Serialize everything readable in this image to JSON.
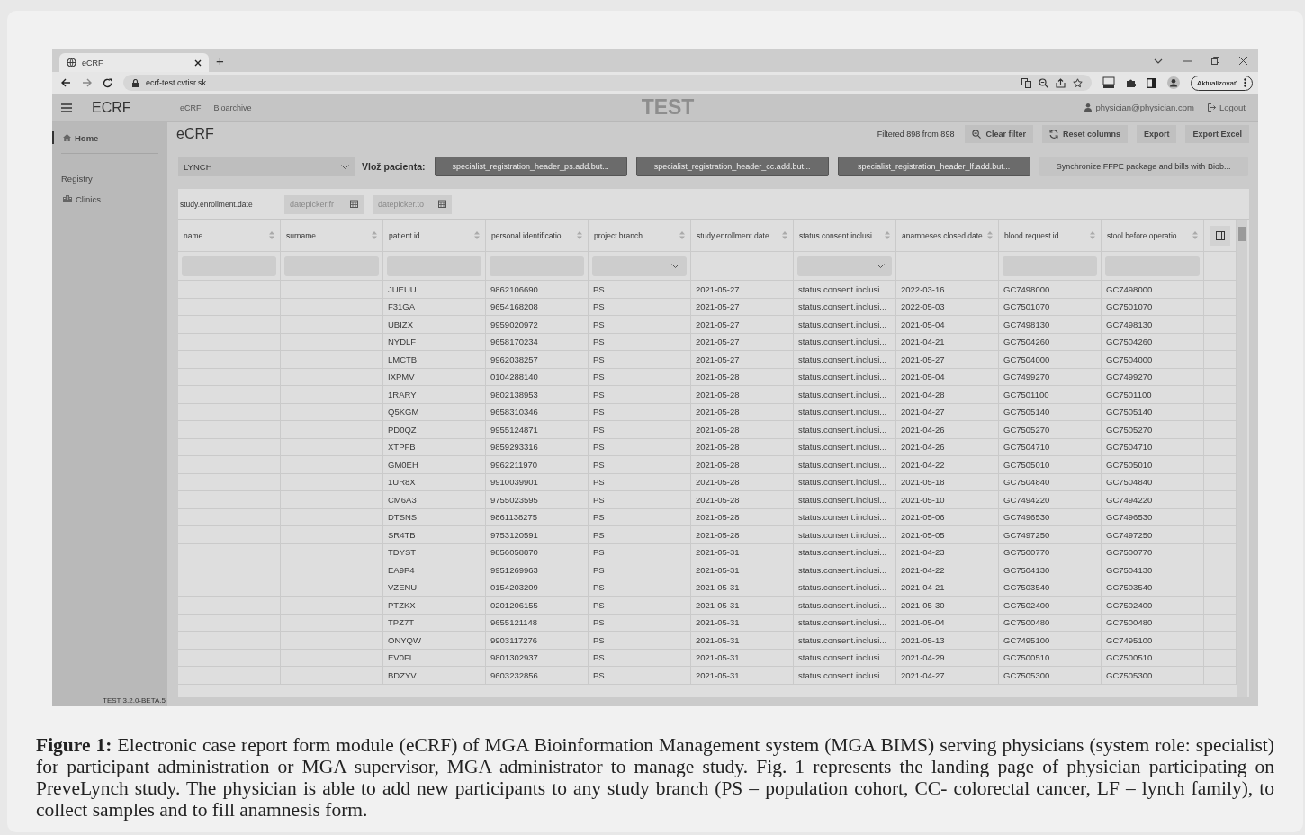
{
  "browser": {
    "tab_title": "eCRF",
    "new_tab": "+",
    "url": "ecrf-test.cvtisr.sk",
    "update_button": "Aktualizovať"
  },
  "app_header": {
    "brand": "ECRF",
    "nav": [
      "eCRF",
      "Bioarchive"
    ],
    "banner": "TEST",
    "user": "physician@physician.com",
    "logout": "Logout"
  },
  "sidebar": {
    "items": [
      {
        "label": "Home",
        "kind": "link",
        "selected": true
      },
      {
        "label": "Registry",
        "kind": "heading",
        "selected": false
      },
      {
        "label": "Clinics",
        "kind": "link",
        "selected": false
      }
    ],
    "version": "TEST 3.2.0-BETA.5"
  },
  "page": {
    "title": "eCRF",
    "filter_status": "Filtered 898 from 898",
    "toolbar": [
      {
        "label": "Clear filter",
        "kind": "clear"
      },
      {
        "label": "Reset columns",
        "kind": "reset"
      },
      {
        "label": "Export",
        "kind": "plain"
      },
      {
        "label": "Export Excel",
        "kind": "plain"
      }
    ]
  },
  "controls": {
    "study_select": "LYNCH",
    "add_label": "Vlož pacienta:",
    "buttons": [
      {
        "label": "specialist_registration_header_ps.add.but...",
        "kind": "dark"
      },
      {
        "label": "specialist_registration_header_cc.add.but...",
        "kind": "dark"
      },
      {
        "label": "specialist_registration_header_lf.add.but...",
        "kind": "dark"
      },
      {
        "label": "Synchronize FFPE package and bills with Biob...",
        "kind": "light"
      }
    ]
  },
  "date_filter": {
    "label": "study.enrollment.date",
    "from_placeholder": "datepicker.fr",
    "to_placeholder": "datepicker.to"
  },
  "table": {
    "columns": [
      {
        "label": "name",
        "kind": "text"
      },
      {
        "label": "surname",
        "kind": "text"
      },
      {
        "label": "patient.id",
        "kind": "text"
      },
      {
        "label": "personal.identificatio...",
        "kind": "text"
      },
      {
        "label": "project.branch",
        "kind": "select"
      },
      {
        "label": "study.enrollment.date",
        "kind": "plain"
      },
      {
        "label": "status.consent.inclusi...",
        "kind": "select"
      },
      {
        "label": "anamneses.closed.date",
        "kind": "plain"
      },
      {
        "label": "blood.request.id",
        "kind": "text"
      },
      {
        "label": "stool.before.operatio...",
        "kind": "text"
      }
    ],
    "rows": [
      [
        "",
        "",
        "JUEUU",
        "9862106690",
        "PS",
        "2021-05-27",
        "status.consent.inclusi...",
        "2022-03-16",
        "GC7498000",
        "GC7498000"
      ],
      [
        "",
        "",
        "F31GA",
        "9654168208",
        "PS",
        "2021-05-27",
        "status.consent.inclusi...",
        "2022-05-03",
        "GC7501070",
        "GC7501070"
      ],
      [
        "",
        "",
        "UBIZX",
        "9959020972",
        "PS",
        "2021-05-27",
        "status.consent.inclusi...",
        "2021-05-04",
        "GC7498130",
        "GC7498130"
      ],
      [
        "",
        "",
        "NYDLF",
        "9658170234",
        "PS",
        "2021-05-27",
        "status.consent.inclusi...",
        "2021-04-21",
        "GC7504260",
        "GC7504260"
      ],
      [
        "",
        "",
        "LMCTB",
        "9962038257",
        "PS",
        "2021-05-27",
        "status.consent.inclusi...",
        "2021-05-27",
        "GC7504000",
        "GC7504000"
      ],
      [
        "",
        "",
        "IXPMV",
        "0104288140",
        "PS",
        "2021-05-28",
        "status.consent.inclusi...",
        "2021-05-04",
        "GC7499270",
        "GC7499270"
      ],
      [
        "",
        "",
        "1RARY",
        "9802138953",
        "PS",
        "2021-05-28",
        "status.consent.inclusi...",
        "2021-04-28",
        "GC7501100",
        "GC7501100"
      ],
      [
        "",
        "",
        "Q5KGM",
        "9658310346",
        "PS",
        "2021-05-28",
        "status.consent.inclusi...",
        "2021-04-27",
        "GC7505140",
        "GC7505140"
      ],
      [
        "",
        "",
        "PD0QZ",
        "9955124871",
        "PS",
        "2021-05-28",
        "status.consent.inclusi...",
        "2021-04-26",
        "GC7505270",
        "GC7505270"
      ],
      [
        "",
        "",
        "XTPFB",
        "9859293316",
        "PS",
        "2021-05-28",
        "status.consent.inclusi...",
        "2021-04-26",
        "GC7504710",
        "GC7504710"
      ],
      [
        "",
        "",
        "GM0EH",
        "9962211970",
        "PS",
        "2021-05-28",
        "status.consent.inclusi...",
        "2021-04-22",
        "GC7505010",
        "GC7505010"
      ],
      [
        "",
        "",
        "1UR8X",
        "9910039901",
        "PS",
        "2021-05-28",
        "status.consent.inclusi...",
        "2021-05-18",
        "GC7504840",
        "GC7504840"
      ],
      [
        "",
        "",
        "CM6A3",
        "9755023595",
        "PS",
        "2021-05-28",
        "status.consent.inclusi...",
        "2021-05-10",
        "GC7494220",
        "GC7494220"
      ],
      [
        "",
        "",
        "DTSNS",
        "9861138275",
        "PS",
        "2021-05-28",
        "status.consent.inclusi...",
        "2021-05-06",
        "GC7496530",
        "GC7496530"
      ],
      [
        "",
        "",
        "SR4TB",
        "9753120591",
        "PS",
        "2021-05-28",
        "status.consent.inclusi...",
        "2021-05-05",
        "GC7497250",
        "GC7497250"
      ],
      [
        "",
        "",
        "TDYST",
        "9856058870",
        "PS",
        "2021-05-31",
        "status.consent.inclusi...",
        "2021-04-23",
        "GC7500770",
        "GC7500770"
      ],
      [
        "",
        "",
        "EA9P4",
        "9951269963",
        "PS",
        "2021-05-31",
        "status.consent.inclusi...",
        "2021-04-22",
        "GC7504130",
        "GC7504130"
      ],
      [
        "",
        "",
        "VZENU",
        "0154203209",
        "PS",
        "2021-05-31",
        "status.consent.inclusi...",
        "2021-04-21",
        "GC7503540",
        "GC7503540"
      ],
      [
        "",
        "",
        "PTZKX",
        "0201206155",
        "PS",
        "2021-05-31",
        "status.consent.inclusi...",
        "2021-05-30",
        "GC7502400",
        "GC7502400"
      ],
      [
        "",
        "",
        "TPZ7T",
        "9655121148",
        "PS",
        "2021-05-31",
        "status.consent.inclusi...",
        "2021-05-04",
        "GC7500480",
        "GC7500480"
      ],
      [
        "",
        "",
        "ONYQW",
        "9903117276",
        "PS",
        "2021-05-31",
        "status.consent.inclusi...",
        "2021-05-13",
        "GC7495100",
        "GC7495100"
      ],
      [
        "",
        "",
        "EV0FL",
        "9801302937",
        "PS",
        "2021-05-31",
        "status.consent.inclusi...",
        "2021-04-29",
        "GC7500510",
        "GC7500510"
      ],
      [
        "",
        "",
        "BDZYV",
        "9603232856",
        "PS",
        "2021-05-31",
        "status.consent.inclusi...",
        "2021-04-27",
        "GC7505300",
        "GC7505300"
      ]
    ]
  },
  "caption": "**Figure 1:** Electronic case report form module (eCRF) of MGA Bioinformation Management system (MGA BIMS) serving physicians (system role: specialist) for participant administration or MGA supervisor, MGA administrator to manage study. Fig. 1 represents the landing page of physician participating on PreveLynch study. The physician is able to add new participants to any study branch (PS – population cohort, CC- colorectal cancer, LF – lynch family), to collect samples and to fill anamnesis form."
}
